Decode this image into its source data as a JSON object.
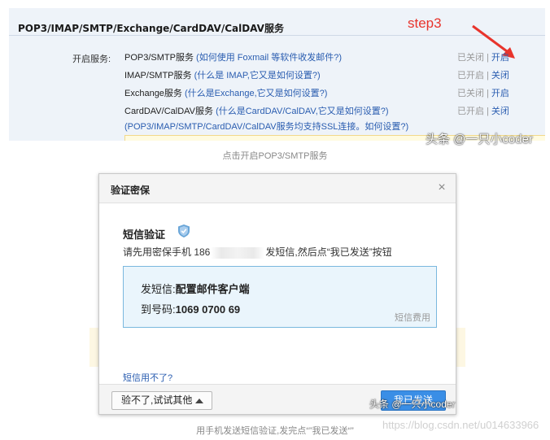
{
  "top_panel": {
    "title": "POP3/IMAP/SMTP/Exchange/CardDAV/CalDAV服务",
    "step_label": "step3",
    "service_label": "开启服务:",
    "services": [
      {
        "name": "POP3/SMTP服务",
        "help": " (如何使用 Foxmail 等软件收发邮件?)",
        "status_left": "已关闭",
        "status_right": "开启"
      },
      {
        "name": "IMAP/SMTP服务",
        "help": " (什么是 IMAP,它又是如何设置?)",
        "status_left": "已开启",
        "status_right": "关闭"
      },
      {
        "name": "Exchange服务",
        "help": " (什么是Exchange,它又是如何设置?)",
        "status_left": "已关闭",
        "status_right": "开启"
      },
      {
        "name": "CardDAV/CalDAV服务",
        "help": " (什么是CardDAV/CalDAV,它又是如何设置?)",
        "status_left": "已开启",
        "status_right": "关闭"
      }
    ],
    "ssl_note": "(POP3/IMAP/SMTP/CardDAV/CalDAV服务均支持SSL连接。如何设置?)",
    "status_separator": "|",
    "watermark": "头条 @一只小coder"
  },
  "caption_1": "点击开启POP3/SMTP服务",
  "dialog": {
    "title": "验证密保",
    "close_glyph": "×",
    "sms_title": "短信验证",
    "instruction_prefix": "请先用密保手机 186",
    "instruction_suffix": "发短信,然后点“我已发送”按钮",
    "send_label": "发短信:",
    "send_content": "配置邮件客户端",
    "number_label": "到号码:",
    "number_value": "1069 0700 69",
    "fee_label": "短信费用",
    "cant_use_link": "短信用不了?",
    "alt_button": "验不了,试试其他",
    "sent_button": "我已发送",
    "watermark": "头条 @一只小coder"
  },
  "caption_2": "用手机发送短信验证,发完点“”我已发送“”",
  "url_watermark": "https://blog.csdn.net/u014633966",
  "colors": {
    "accent_red": "#e8342c",
    "link_blue": "#2a5db0",
    "button_blue": "#3a8ee6",
    "panel_bg": "#eef3f9",
    "sms_box_bg": "#eaf5fc"
  }
}
